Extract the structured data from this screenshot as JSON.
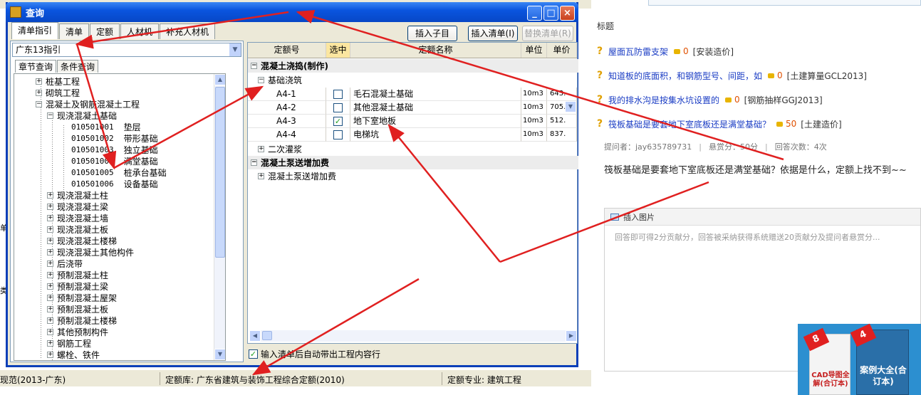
{
  "dialog": {
    "title": "查询",
    "tabs": [
      "清单指引",
      "清单",
      "定额",
      "人材机",
      "补充人材机"
    ],
    "buttons": {
      "insert_child": "插入子目",
      "insert_list": "插入清单(I)",
      "replace_list": "替换清单(R)"
    },
    "combo_value": "广东13指引",
    "subtabs": [
      "章节查询",
      "条件查询"
    ],
    "tree": [
      {
        "label": "桩基工程",
        "pm": "+"
      },
      {
        "label": "砌筑工程",
        "pm": "+"
      },
      {
        "label": "混凝土及钢筋混凝土工程",
        "pm": "-"
      },
      {
        "label": "现浇混凝土基础",
        "pm": "-"
      },
      {
        "code": "010501001",
        "label": "垫层"
      },
      {
        "code": "010501002",
        "label": "带形基础"
      },
      {
        "code": "010501003",
        "label": "独立基础"
      },
      {
        "code": "010501004",
        "label": "满堂基础"
      },
      {
        "code": "010501005",
        "label": "桩承台基础"
      },
      {
        "code": "010501006",
        "label": "设备基础"
      },
      {
        "label": "现浇混凝土柱",
        "pm": "+"
      },
      {
        "label": "现浇混凝土梁",
        "pm": "+"
      },
      {
        "label": "现浇混凝土墙",
        "pm": "+"
      },
      {
        "label": "现浇混凝土板",
        "pm": "+"
      },
      {
        "label": "现浇混凝土楼梯",
        "pm": "+"
      },
      {
        "label": "现浇混凝土其他构件",
        "pm": "+"
      },
      {
        "label": "后浇带",
        "pm": "+"
      },
      {
        "label": "预制混凝土柱",
        "pm": "+"
      },
      {
        "label": "预制混凝土梁",
        "pm": "+"
      },
      {
        "label": "预制混凝土屋架",
        "pm": "+"
      },
      {
        "label": "预制混凝土板",
        "pm": "+"
      },
      {
        "label": "预制混凝土楼梯",
        "pm": "+"
      },
      {
        "label": "其他预制构件",
        "pm": "+"
      },
      {
        "label": "钢筋工程",
        "pm": "+"
      },
      {
        "label": "螺栓、铁件",
        "pm": "+"
      }
    ],
    "grid": {
      "headers": [
        "定额号",
        "选中",
        "定额名称",
        "单位",
        "单价"
      ],
      "group1": "混凝土浇捣(制作)",
      "sub1": "基础浇筑",
      "rows": [
        {
          "code": "A4-1",
          "checked": false,
          "name": "毛石混凝土基础",
          "unit": "10m3",
          "price": "643."
        },
        {
          "code": "A4-2",
          "checked": false,
          "name": "其他混凝土基础",
          "unit": "10m3",
          "price": "705."
        },
        {
          "code": "A4-3",
          "checked": true,
          "name": "地下室地板",
          "unit": "10m3",
          "price": "512."
        },
        {
          "code": "A4-4",
          "checked": false,
          "name": "电梯坑",
          "unit": "10m3",
          "price": "837."
        }
      ],
      "sub2": "二次灌浆",
      "group2": "混凝土泵送增加费",
      "sub3": "混凝土泵送增加费"
    },
    "auto_checkbox": "输入清单后自动带出工程内容行"
  },
  "statusbar": {
    "left": "现范(2013-广东)",
    "mid": "定额库: 广东省建筑与装饰工程综合定额(2010)",
    "right": "定额专业: 建筑工程"
  },
  "qa_page": {
    "biaoti_fragment": "标题",
    "questions": [
      {
        "title": "屋面瓦防雷支架",
        "coins": "0",
        "tag": "[安装造价]"
      },
      {
        "title": "知道板的底面积，和钢筋型号、间距，如",
        "coins": "0",
        "tag": "[土建算量GCL2013]"
      },
      {
        "title": "我的排水沟是按集水坑设置的",
        "coins": "0",
        "tag": "[钢筋抽样GGJ2013]"
      },
      {
        "title": "筏板基础是要套地下室底板还是满堂基础？",
        "coins": "50",
        "tag": "[土建造价]"
      }
    ],
    "meta": {
      "asker": "提问者：jay635789731",
      "reward": "悬赏分：50分",
      "answers": "回答次数：4次"
    },
    "question_text": "筏板基础是要套地下室底板还是满堂基础？依据是什么，定额上找不到~~",
    "answer": {
      "insert_image": "插入图片",
      "placeholder": "回答即可得2分贡献分，回答被采纳获得系统赠送20贡献分及提问者悬赏分..."
    },
    "ad": {
      "left_tag": "8",
      "left_text": "CAD导图全解(合订本)",
      "right_tag": "4",
      "right_text": "案例大全(合订本)"
    }
  },
  "left_edge": {
    "a": "单",
    "b": "类别"
  },
  "colors": {
    "titlebar": "#0a55df",
    "arrow": "#e02020",
    "link": "#1a3cc4"
  }
}
